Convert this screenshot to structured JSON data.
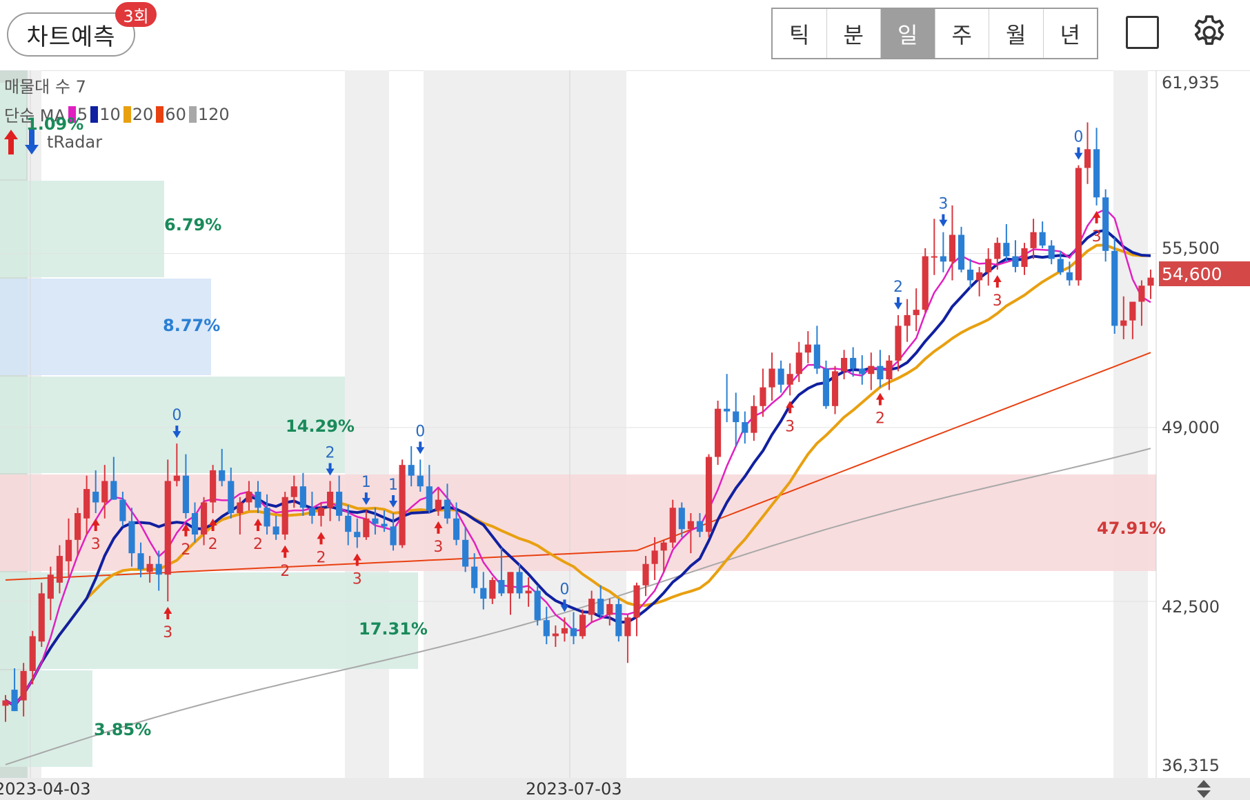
{
  "header": {
    "predict_label": "차트예측",
    "predict_badge": "3회",
    "periods": [
      "틱",
      "분",
      "일",
      "주",
      "월",
      "년"
    ],
    "active_period": "일"
  },
  "legend": {
    "volume_profile": "매물대 수 7",
    "ma_label": "단순 MA",
    "ma_items": [
      {
        "period": "5",
        "color": "#e020c0"
      },
      {
        "period": "10",
        "color": "#1020a0"
      },
      {
        "period": "20",
        "color": "#e8a010"
      },
      {
        "period": "60",
        "color": "#e84010"
      },
      {
        "period": "120",
        "color": "#a8a8a8"
      }
    ],
    "radar_label": "tRadar"
  },
  "price_axis": {
    "ticks": [
      "61,935",
      "55,500",
      "49,000",
      "42,500",
      "36,315"
    ],
    "current_price": "54,600"
  },
  "date_axis": {
    "ticks": [
      "2023-04-03",
      "2023-07-03"
    ]
  },
  "volume_profile_labels": [
    "1.09%",
    "6.79%",
    "8.77%",
    "14.29%",
    "47.91%",
    "17.31%",
    "3.85%"
  ],
  "signal_labels": [
    "2",
    "0",
    "3",
    "3",
    "2",
    "2",
    "2",
    "2",
    "3",
    "1",
    "2",
    "1",
    "0",
    "3",
    "0",
    "3",
    "2",
    "3",
    "2",
    "3",
    "0",
    "3"
  ],
  "colors": {
    "up": "#d9363e",
    "down": "#2a7fd4",
    "ma5": "#e020c0",
    "ma10": "#1020a0",
    "ma20": "#e8a010",
    "ma60": "#e84010",
    "ma120": "#a8a8a8",
    "band_green": "#d6ece3",
    "band_blue": "#d6e6f7",
    "band_red": "#f7d9da"
  },
  "chart_data": {
    "type": "candlestick",
    "y_range": [
      36315,
      61935
    ],
    "current_price": 54600,
    "candles": [
      [
        38600,
        39000,
        38000,
        38800
      ],
      [
        39200,
        40000,
        38400,
        38400
      ],
      [
        38800,
        40200,
        38200,
        39900
      ],
      [
        39900,
        41400,
        39400,
        41200
      ],
      [
        41000,
        43200,
        40800,
        42800
      ],
      [
        42600,
        43800,
        41800,
        43500
      ],
      [
        43200,
        44600,
        42800,
        44200
      ],
      [
        44000,
        45600,
        43400,
        44800
      ],
      [
        44800,
        46000,
        44200,
        45800
      ],
      [
        45600,
        47200,
        45000,
        46700
      ],
      [
        46600,
        47400,
        45800,
        46200
      ],
      [
        46200,
        47600,
        45600,
        47000
      ],
      [
        47000,
        47900,
        46300,
        46300
      ],
      [
        46300,
        46600,
        45300,
        45500
      ],
      [
        45500,
        46000,
        43800,
        44300
      ],
      [
        44300,
        44700,
        43400,
        43700
      ],
      [
        43600,
        44200,
        43200,
        43900
      ],
      [
        43900,
        44400,
        42900,
        43500
      ],
      [
        43500,
        47800,
        42500,
        47000
      ],
      [
        47000,
        48400,
        46800,
        47200
      ],
      [
        47200,
        48000,
        45600,
        45800
      ],
      [
        45800,
        46200,
        44700,
        45000
      ],
      [
        45000,
        46400,
        44600,
        46200
      ],
      [
        46200,
        47600,
        45800,
        47400
      ],
      [
        47400,
        48200,
        46800,
        47000
      ],
      [
        47000,
        47500,
        45600,
        45800
      ],
      [
        45800,
        46400,
        45000,
        46200
      ],
      [
        46200,
        47000,
        45900,
        46600
      ],
      [
        46600,
        47000,
        45800,
        46000
      ],
      [
        46000,
        46500,
        45000,
        45300
      ],
      [
        45300,
        45700,
        44800,
        45000
      ],
      [
        45000,
        46600,
        44800,
        46400
      ],
      [
        46400,
        47200,
        46000,
        46800
      ],
      [
        46800,
        47300,
        45700,
        46000
      ],
      [
        46000,
        46600,
        45400,
        45700
      ],
      [
        45700,
        46200,
        45300,
        46000
      ],
      [
        46000,
        47000,
        45500,
        46600
      ],
      [
        46600,
        47200,
        45500,
        45700
      ],
      [
        45700,
        46100,
        44600,
        45100
      ],
      [
        45100,
        45600,
        44500,
        44900
      ],
      [
        44900,
        45900,
        44800,
        45600
      ],
      [
        45600,
        46000,
        45000,
        45400
      ],
      [
        45400,
        45900,
        45100,
        45300
      ],
      [
        45300,
        45800,
        44400,
        44600
      ],
      [
        44600,
        47800,
        44500,
        47600
      ],
      [
        47600,
        48300,
        46800,
        47200
      ],
      [
        47200,
        47800,
        46600,
        46800
      ],
      [
        46800,
        47600,
        45800,
        45900
      ],
      [
        45900,
        46700,
        45700,
        46300
      ],
      [
        46300,
        46900,
        45400,
        45600
      ],
      [
        45600,
        46200,
        44600,
        44800
      ],
      [
        44800,
        45300,
        43600,
        43800
      ],
      [
        43800,
        44300,
        42800,
        43000
      ],
      [
        43000,
        43600,
        42200,
        42600
      ],
      [
        42600,
        43400,
        42400,
        43300
      ],
      [
        43300,
        44500,
        42700,
        42800
      ],
      [
        42800,
        43600,
        42000,
        43600
      ],
      [
        43600,
        43900,
        42600,
        42800
      ],
      [
        42800,
        43400,
        42300,
        42900
      ],
      [
        42900,
        43100,
        41600,
        41800
      ],
      [
        41800,
        42300,
        40900,
        41200
      ],
      [
        41200,
        41600,
        40800,
        41300
      ],
      [
        41300,
        41900,
        41000,
        41500
      ],
      [
        41500,
        42100,
        40900,
        41200
      ],
      [
        41200,
        42200,
        41100,
        42000
      ],
      [
        42000,
        42900,
        41700,
        42600
      ],
      [
        42600,
        43100,
        41900,
        42000
      ],
      [
        42000,
        42600,
        41600,
        42400
      ],
      [
        42400,
        42600,
        41000,
        41200
      ],
      [
        41200,
        42000,
        40200,
        41900
      ],
      [
        41900,
        43200,
        41200,
        43100
      ],
      [
        43100,
        44200,
        42700,
        43900
      ],
      [
        43900,
        44900,
        43300,
        44400
      ],
      [
        44400,
        44800,
        43600,
        44700
      ],
      [
        44700,
        46300,
        44500,
        46000
      ],
      [
        46000,
        46200,
        44900,
        45200
      ],
      [
        45200,
        45800,
        44300,
        45500
      ],
      [
        45500,
        45800,
        44900,
        45100
      ],
      [
        45100,
        48000,
        44900,
        47900
      ],
      [
        47900,
        50000,
        47600,
        49700
      ],
      [
        49700,
        51000,
        49200,
        49600
      ],
      [
        49600,
        50300,
        48300,
        49200
      ],
      [
        49200,
        49600,
        48400,
        48800
      ],
      [
        48800,
        50200,
        48500,
        49800
      ],
      [
        49800,
        51200,
        49400,
        50500
      ],
      [
        50500,
        51800,
        50000,
        51200
      ],
      [
        51200,
        51500,
        50300,
        50600
      ],
      [
        50600,
        51400,
        50200,
        51000
      ],
      [
        51000,
        52200,
        50700,
        51800
      ],
      [
        51800,
        52600,
        51400,
        52100
      ],
      [
        52100,
        52800,
        51000,
        51200
      ],
      [
        51200,
        51500,
        49700,
        49800
      ],
      [
        49800,
        51300,
        49500,
        51100
      ],
      [
        51100,
        51900,
        50800,
        51600
      ],
      [
        51600,
        52000,
        50900,
        51200
      ],
      [
        51200,
        51700,
        50600,
        51000
      ],
      [
        51000,
        51800,
        50400,
        51300
      ],
      [
        51300,
        51900,
        50500,
        50800
      ],
      [
        50800,
        51700,
        50400,
        51500
      ],
      [
        51500,
        53200,
        51100,
        52800
      ],
      [
        52800,
        53800,
        52200,
        53200
      ],
      [
        53200,
        54200,
        52600,
        53400
      ],
      [
        53400,
        55700,
        53300,
        55400
      ],
      [
        55400,
        56800,
        54700,
        55400
      ],
      [
        55400,
        56300,
        54800,
        55200
      ],
      [
        55200,
        57300,
        54500,
        56200
      ],
      [
        56200,
        56500,
        54800,
        54900
      ],
      [
        54900,
        55300,
        54200,
        54500
      ],
      [
        54500,
        55000,
        53900,
        54800
      ],
      [
        54800,
        55700,
        54300,
        55300
      ],
      [
        55300,
        56100,
        54900,
        55900
      ],
      [
        55900,
        56600,
        55200,
        55400
      ],
      [
        55400,
        56000,
        54800,
        55000
      ],
      [
        55000,
        55900,
        54700,
        55700
      ],
      [
        55700,
        56800,
        55300,
        56300
      ],
      [
        56300,
        56700,
        55700,
        55800
      ],
      [
        55800,
        56000,
        55100,
        55300
      ],
      [
        55300,
        55600,
        54700,
        54800
      ],
      [
        54800,
        55200,
        54300,
        54500
      ],
      [
        54500,
        58800,
        54300,
        58700
      ],
      [
        58700,
        60400,
        58100,
        59400
      ],
      [
        59400,
        60200,
        57300,
        57600
      ],
      [
        57600,
        57900,
        55200,
        55600
      ],
      [
        55600,
        56100,
        52500,
        52800
      ],
      [
        52800,
        53900,
        52300,
        53000
      ],
      [
        53000,
        53600,
        52300,
        53700
      ],
      [
        53700,
        54500,
        52800,
        54300
      ],
      [
        54300,
        54900,
        53800,
        54600
      ]
    ]
  }
}
